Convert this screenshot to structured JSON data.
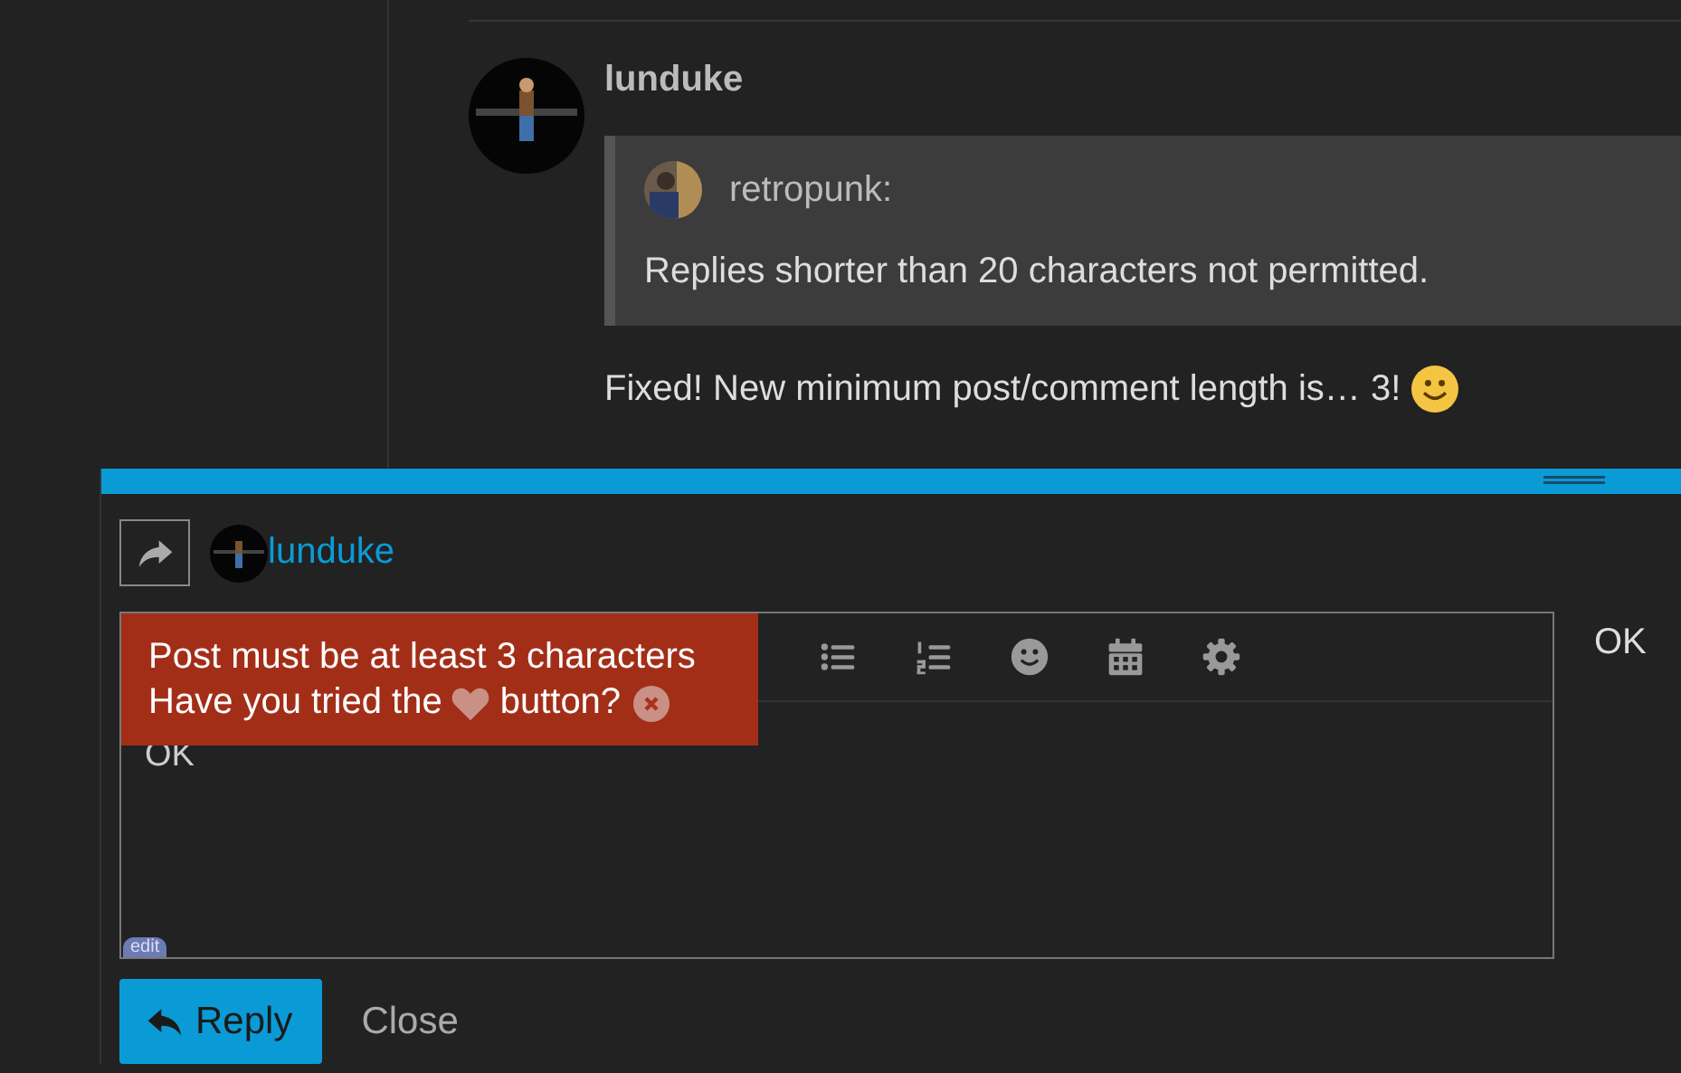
{
  "post": {
    "author": "lunduke",
    "quote": {
      "author": "retropunk:",
      "text": "Replies shorter than 20 characters not permitted."
    },
    "body": "Fixed! New minimum post/comment length is… 3!"
  },
  "composer": {
    "reply_to": "lunduke",
    "value": "OK",
    "preview": "OK",
    "badge": "edit",
    "tooltip": {
      "line1": "Post must be at least 3 characters",
      "line2_before": "Have you tried the",
      "line2_after": "button?"
    },
    "buttons": [
      {
        "kind": "primary",
        "label": "Reply"
      },
      {
        "kind": "link",
        "label": "Close"
      }
    ]
  }
}
